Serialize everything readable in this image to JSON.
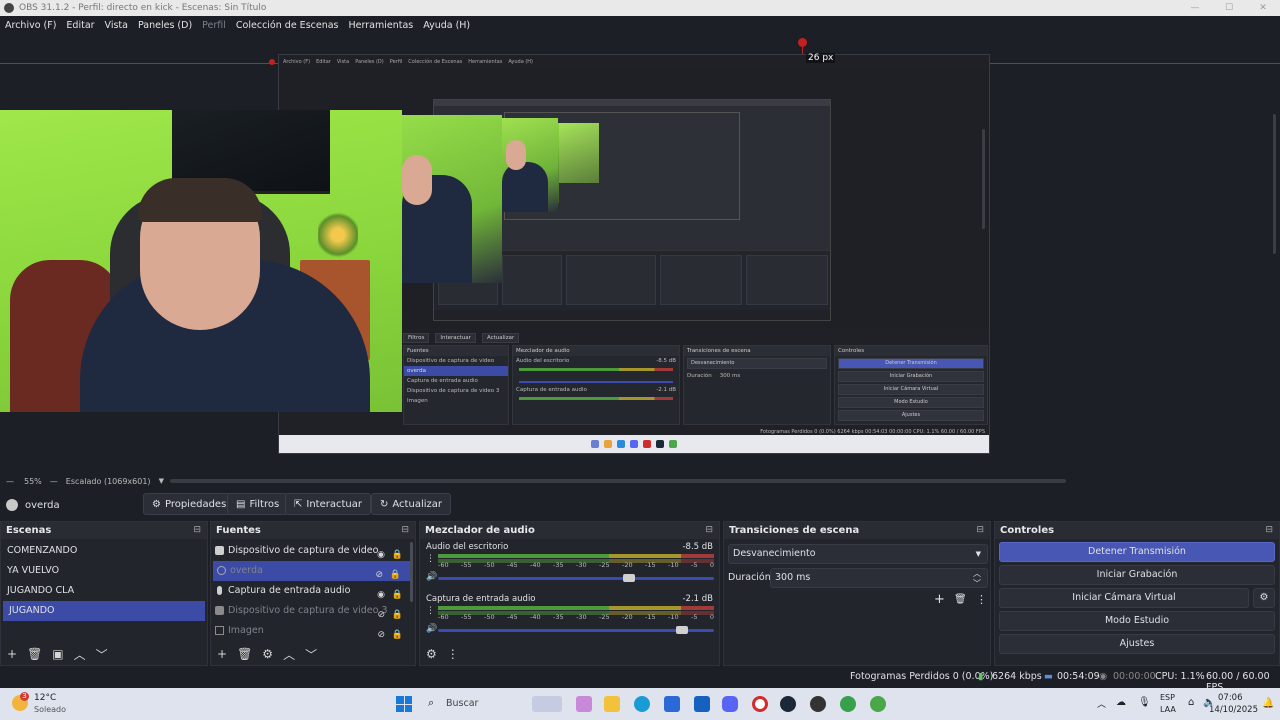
{
  "window": {
    "title": "OBS 31.1.2 - Perfil: directo en kick - Escenas: Sin Título"
  },
  "menu": [
    "Archivo (F)",
    "Editar",
    "Vista",
    "Paneles (D)",
    "Perfil",
    "Colección de Escenas",
    "Herramientas",
    "Ayuda (H)"
  ],
  "preview": {
    "guide_label": "26 px",
    "inner_menu": [
      "Archivo (F)",
      "Editar",
      "Vista",
      "Paneles (D)",
      "Perfil",
      "Colección de Escenas",
      "Herramientas",
      "Ayuda (H)"
    ],
    "inner_tabs": [
      "Filtros",
      "Interactuar",
      "Actualizar"
    ],
    "inner_docks": {
      "sources_title": "Fuentes",
      "sources": [
        "Dispositivo de captura de video",
        "overda",
        "Captura de entrada audio",
        "Dispositivo de captura de video 3",
        "Imagen"
      ],
      "mixer_title": "Mezclador de audio",
      "mixer_ch1": "Audio del escritorio",
      "mixer_ch1_db": "-8.5 dB",
      "mixer_ch2": "Captura de entrada audio",
      "mixer_ch2_db": "-2.1 dB",
      "transitions_title": "Transiciones de escena",
      "transition": "Desvanecimiento",
      "duration_label": "Duración",
      "duration": "300 ms",
      "controls_title": "Controles",
      "controls": [
        "Detener Transmisión",
        "Iniciar Grabación",
        "Iniciar Cámara Virtual",
        "Modo Estudio",
        "Ajustes"
      ]
    },
    "inner_status": "Fotogramas Perdidos 0 (0.0%)   6264 kbps   00:54:03   00:00:00   CPU: 1.1%   60.00 / 60.00 FPS"
  },
  "zoom": {
    "percent": "55%",
    "scale": "Escalado (1069x601)"
  },
  "source_toolbar": {
    "selected_source": "overda",
    "properties": "Propiedades",
    "filters": "Filtros",
    "interact": "Interactuar",
    "refresh": "Actualizar"
  },
  "scenes": {
    "title": "Escenas",
    "items": [
      "COMENZANDO",
      "YA VUELVO",
      "JUGANDO CLA",
      "JUGANDO"
    ],
    "selected": 3
  },
  "sources": {
    "title": "Fuentes",
    "items": [
      {
        "name": "Dispositivo de captura de video",
        "icon": "camera-icon",
        "visible": true
      },
      {
        "name": "overda",
        "icon": "browser-icon",
        "visible": false
      },
      {
        "name": "Captura de entrada audio",
        "icon": "microphone-icon",
        "visible": true
      },
      {
        "name": "Dispositivo de captura de video 3",
        "icon": "camera-icon",
        "visible": false
      },
      {
        "name": "Imagen",
        "icon": "image-icon",
        "visible": false
      }
    ]
  },
  "mixer": {
    "title": "Mezclador de audio",
    "ticks": [
      "-60",
      "-55",
      "-50",
      "-45",
      "-40",
      "-35",
      "-30",
      "-25",
      "-20",
      "-15",
      "-10",
      "-5",
      "0"
    ],
    "channels": [
      {
        "name": "Audio del escritorio",
        "db": "-8.5 dB",
        "volume": 0.7
      },
      {
        "name": "Captura de entrada audio",
        "db": "-2.1 dB",
        "volume": 0.9
      }
    ]
  },
  "transitions": {
    "title": "Transiciones de escena",
    "selected": "Desvanecimiento",
    "duration_label": "Duración",
    "duration": "300 ms"
  },
  "controls": {
    "title": "Controles",
    "stop_stream": "Detener Transmisión",
    "start_record": "Iniciar Grabación",
    "start_vcam": "Iniciar Cámara Virtual",
    "studio_mode": "Modo Estudio",
    "settings": "Ajustes"
  },
  "status": {
    "dropped": "Fotogramas Perdidos 0 (0.0%)",
    "bitrate": "6264 kbps",
    "stream_time": "00:54:09",
    "record_time": "00:00:00",
    "cpu": "CPU: 1.1%",
    "fps": "60.00 / 60.00 FPS"
  },
  "taskbar": {
    "weather_temp": "12°C",
    "weather_desc": "Soleado",
    "weather_badge": "3",
    "search_placeholder": "Buscar",
    "lang": "ESP",
    "lang2": "LAA",
    "time": "07:06",
    "date": "14/10/2025"
  }
}
